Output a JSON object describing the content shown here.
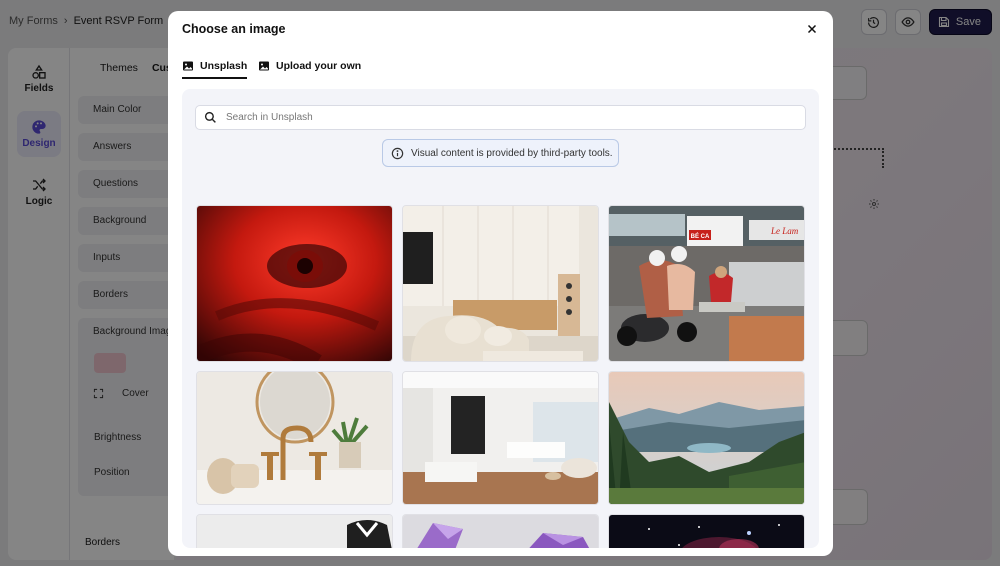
{
  "app": {
    "breadcrumb": [
      "My Forms",
      "Event RSVP Form"
    ],
    "breadcrumb_sep": "›",
    "save_label": "Save",
    "rail": [
      {
        "label": "Fields",
        "icon": "shapes-icon"
      },
      {
        "label": "Design",
        "icon": "palette-icon"
      },
      {
        "label": "Logic",
        "icon": "shuffle-icon"
      }
    ],
    "panel_tabs": [
      "Themes",
      "Cus"
    ],
    "panel_rows": [
      "Main Color",
      "Answers",
      "Questions",
      "Background",
      "Inputs",
      "Borders",
      "Background Imag"
    ],
    "cover_label": "Cover",
    "brightness_label": "Brightness",
    "position_label": "Position",
    "borders_footer_label": "Borders"
  },
  "modal": {
    "title": "Choose an image",
    "tabs": [
      {
        "label": "Unsplash",
        "icon": "image-icon",
        "active": true
      },
      {
        "label": "Upload your own",
        "icon": "image-icon",
        "active": false
      }
    ],
    "search_placeholder": "Search in Unsplash",
    "notice": "Visual content is provided by third-party tools.",
    "images": [
      {
        "id": "eye-red"
      },
      {
        "id": "living-room"
      },
      {
        "id": "street-scooter",
        "signs": [
          "BÉ CA",
          "Le Lam"
        ]
      },
      {
        "id": "bathroom-sink"
      },
      {
        "id": "white-interior"
      },
      {
        "id": "mountain-lake"
      },
      {
        "id": "white-sculpture"
      },
      {
        "id": "purple-crystals"
      },
      {
        "id": "nebula"
      }
    ]
  },
  "colors": {
    "accent": "#5a4bd6",
    "save_bg": "#1f1b4d",
    "notice_border": "#b9c9e6"
  }
}
